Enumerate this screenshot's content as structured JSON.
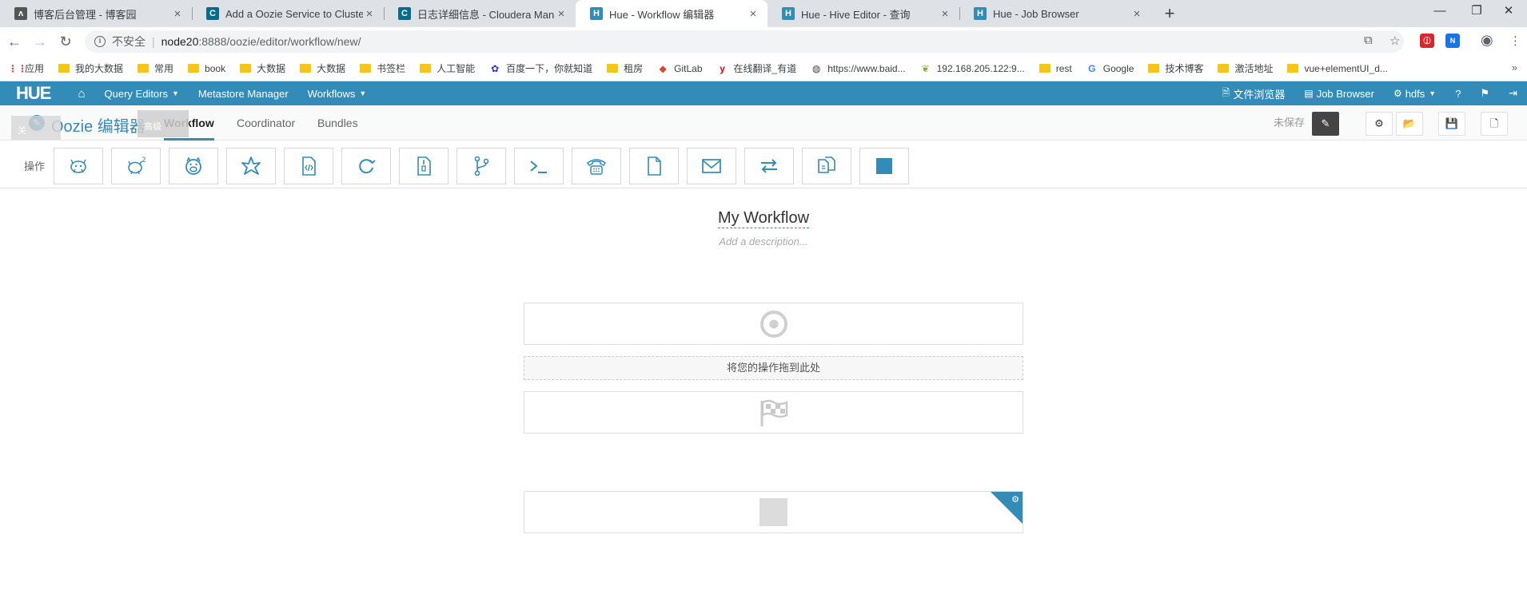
{
  "browser": {
    "tabs": [
      {
        "title": "博客后台管理 - 博客园",
        "icon": "cnblogs-icon",
        "icon_glyph": "ᴧ",
        "icon_color": "#555555"
      },
      {
        "title": "Add a Oozie Service to Cluster",
        "icon": "cloudera-icon",
        "icon_glyph": "C",
        "icon_color": "#0b6a8a"
      },
      {
        "title": "日志详细信息 - Cloudera Manager",
        "icon": "cloudera-icon",
        "icon_glyph": "C",
        "icon_color": "#0b6a8a"
      },
      {
        "title": "Hue - Workflow 编辑器",
        "icon": "hue-icon",
        "icon_glyph": "H",
        "icon_color": "#338bb8"
      },
      {
        "title": "Hue - Hive Editor - 查询",
        "icon": "hue-icon",
        "icon_glyph": "H",
        "icon_color": "#338bb8"
      },
      {
        "title": "Hue - Job Browser",
        "icon": "hue-icon",
        "icon_glyph": "H",
        "icon_color": "#338bb8"
      }
    ],
    "address": {
      "insecure_label": "不安全",
      "host": "node20",
      "path": ":8888/oozie/editor/workflow/new/"
    },
    "bookmarks": [
      {
        "label": "应用",
        "type": "apps"
      },
      {
        "label": "我的大数据",
        "type": "folder"
      },
      {
        "label": "常用",
        "type": "folder"
      },
      {
        "label": "book",
        "type": "folder"
      },
      {
        "label": "大数据",
        "type": "folder"
      },
      {
        "label": "大数据",
        "type": "folder"
      },
      {
        "label": "书签栏",
        "type": "folder"
      },
      {
        "label": "人工智能",
        "type": "folder"
      },
      {
        "label": "百度一下，你就知道",
        "type": "baidu"
      },
      {
        "label": "租房",
        "type": "folder"
      },
      {
        "label": "GitLab",
        "type": "gitlab"
      },
      {
        "label": "在线翻译_有道",
        "type": "youdao"
      },
      {
        "label": "https://www.baid...",
        "type": "globe"
      },
      {
        "label": "192.168.205.122:9...",
        "type": "leaf"
      },
      {
        "label": "rest",
        "type": "folder"
      },
      {
        "label": "Google",
        "type": "google"
      },
      {
        "label": "技术博客",
        "type": "folder"
      },
      {
        "label": "激活地址",
        "type": "folder"
      },
      {
        "label": "vue+elementUI_d...",
        "type": "folder"
      }
    ]
  },
  "hue": {
    "logo": "HUE",
    "nav": [
      {
        "label": "Query Editors",
        "dropdown": true
      },
      {
        "label": "Metastore Manager",
        "dropdown": false
      },
      {
        "label": "Workflows",
        "dropdown": true
      }
    ],
    "nav_right": [
      {
        "label": "文件浏览器",
        "icon": "file-icon"
      },
      {
        "label": "Job Browser",
        "icon": "list-icon"
      },
      {
        "label": "hdfs",
        "icon": "gears-icon"
      }
    ]
  },
  "editor": {
    "title": "Oozie 编辑器",
    "tabs": [
      "Workflow",
      "Coordinator",
      "Bundles"
    ],
    "active_tab": "Workflow",
    "unsaved_label": "未保存",
    "ghost_label_1": "关",
    "ghost_label_2": "高级"
  },
  "actions": {
    "label": "操作",
    "items": [
      "hive-action",
      "hive2-action",
      "pig-action",
      "spark-action",
      "java-action",
      "subworkflow-action",
      "mapreduce-jar-action",
      "fork-action",
      "shell-action",
      "ssh-action",
      "fs-action",
      "email-action",
      "distcp-action",
      "generic-action",
      "kill-node-action"
    ]
  },
  "workflow": {
    "name": "My Workflow",
    "description_placeholder": "Add a description...",
    "dropzone_label": "将您的操作拖到此处"
  },
  "colors": {
    "brand": "#338bb8"
  }
}
